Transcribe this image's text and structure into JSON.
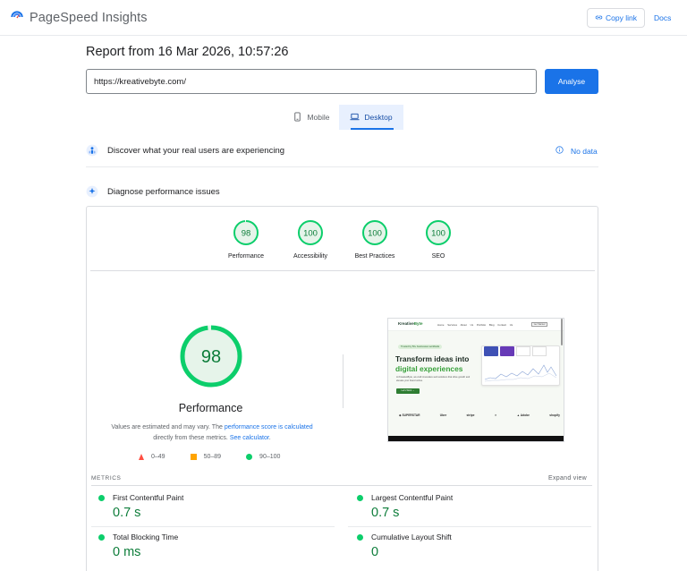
{
  "header": {
    "app_title": "PageSpeed Insights",
    "copy_link": "Copy link",
    "docs": "Docs",
    "logo_icon": "pagespeed-logo-icon",
    "link_icon": "link-icon"
  },
  "report": {
    "title": "Report from 16 Mar 2026, 10:57:26"
  },
  "url_bar": {
    "value": "https://kreativebyte.com/",
    "analyse_label": "Analyse"
  },
  "device_tabs": {
    "mobile": "Mobile",
    "desktop": "Desktop",
    "selected": "Desktop"
  },
  "sections": {
    "discover": "Discover what your real users are experiencing",
    "no_data": "No data",
    "diagnose": "Diagnose performance issues"
  },
  "scores": [
    {
      "label": "Performance",
      "value": "98"
    },
    {
      "label": "Accessibility",
      "value": "100"
    },
    {
      "label": "Best Practices",
      "value": "100"
    },
    {
      "label": "SEO",
      "value": "100"
    }
  ],
  "performance": {
    "score": "98",
    "score_fraction": 0.98,
    "title": "Performance",
    "desc_1": "Values are estimated and may vary. The ",
    "desc_link_1": "performance score is calculated",
    "desc_2": " directly from these metrics. ",
    "desc_link_2": "See calculator",
    "desc_3": ".",
    "legend": {
      "fail": "0–49",
      "average": "50–89",
      "pass": "90–100"
    }
  },
  "thumbnail": {
    "logo": "Kreative",
    "logo_accent": "Byte",
    "nav": "Home Services About Us Portfolio Blog Contact Us",
    "top_btn": "Get Started",
    "tag": "Trusted by 50+ businesses worldwide",
    "headline_1": "Transform ideas into",
    "headline_2": "digital experiences",
    "sub": "At KreativeByte, we craft innovative web solutions that drive growth and elevate your brand online.",
    "cta": "Let's Work →",
    "logos": [
      "◆ SUPERSTAR",
      "Uber",
      "stripe",
      "✕",
      "▲ Adobe",
      "shopify"
    ]
  },
  "metrics": {
    "title": "METRICS",
    "expand": "Expand view",
    "items": [
      {
        "name": "First Contentful Paint",
        "value": "0.7 s"
      },
      {
        "name": "Largest Contentful Paint",
        "value": "0.7 s"
      },
      {
        "name": "Total Blocking Time",
        "value": "0 ms"
      },
      {
        "name": "Cumulative Layout Shift",
        "value": "0"
      }
    ]
  },
  "colors": {
    "accent": "#1a73e8",
    "pass": "#0cce6b",
    "pass_text": "#0d7d3a",
    "pass_fill": "#e6f4ea",
    "average": "#ffa400",
    "fail": "#ff4e42"
  }
}
